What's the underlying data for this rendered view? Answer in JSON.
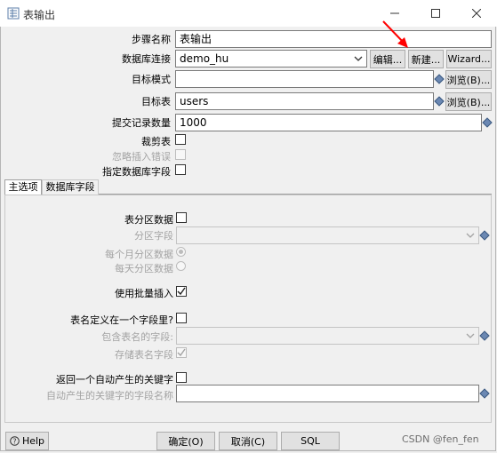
{
  "window": {
    "title": "表输出"
  },
  "fields": {
    "step_name": {
      "label": "步骤名称",
      "value": "表输出"
    },
    "db_connection": {
      "label": "数据库连接",
      "value": "demo_hu",
      "edit_btn": "编辑...",
      "new_btn": "新建...",
      "wizard_btn": "Wizard..."
    },
    "target_schema": {
      "label": "目标模式",
      "value": "",
      "browse_btn": "浏览(B)..."
    },
    "target_table": {
      "label": "目标表",
      "value": "users",
      "browse_btn": "浏览(B)..."
    },
    "commit_size": {
      "label": "提交记录数量",
      "value": "1000"
    },
    "truncate_table": {
      "label": "裁剪表"
    },
    "ignore_insert_errors": {
      "label": "忽略插入错误"
    },
    "specify_db_fields": {
      "label": "指定数据库字段"
    }
  },
  "tabs": [
    {
      "label": "主选项"
    },
    {
      "label": "数据库字段"
    }
  ],
  "main_options": {
    "partition_data": {
      "label": "表分区数据"
    },
    "partition_field": {
      "label": "分区字段"
    },
    "partition_monthly": {
      "label": "每个月分区数据"
    },
    "partition_daily": {
      "label": "每天分区数据"
    },
    "use_batch_insert": {
      "label": "使用批量插入"
    },
    "tablename_in_field": {
      "label": "表名定义在一个字段里?"
    },
    "tablename_field": {
      "label": "包含表名的字段:"
    },
    "store_tablename_field": {
      "label": "存储表名字段"
    },
    "return_auto_key": {
      "label": "返回一个自动产生的关键字"
    },
    "auto_key_field_name": {
      "label": "自动产生的关键字的字段名称"
    }
  },
  "footer": {
    "help": "Help",
    "ok": "确定(O)",
    "cancel": "取消(C)",
    "sql": "SQL"
  },
  "watermark": "CSDN @fen_fen",
  "colors": {
    "annotation_arrow": "#ff0000",
    "diamond": "#6b88b3"
  }
}
